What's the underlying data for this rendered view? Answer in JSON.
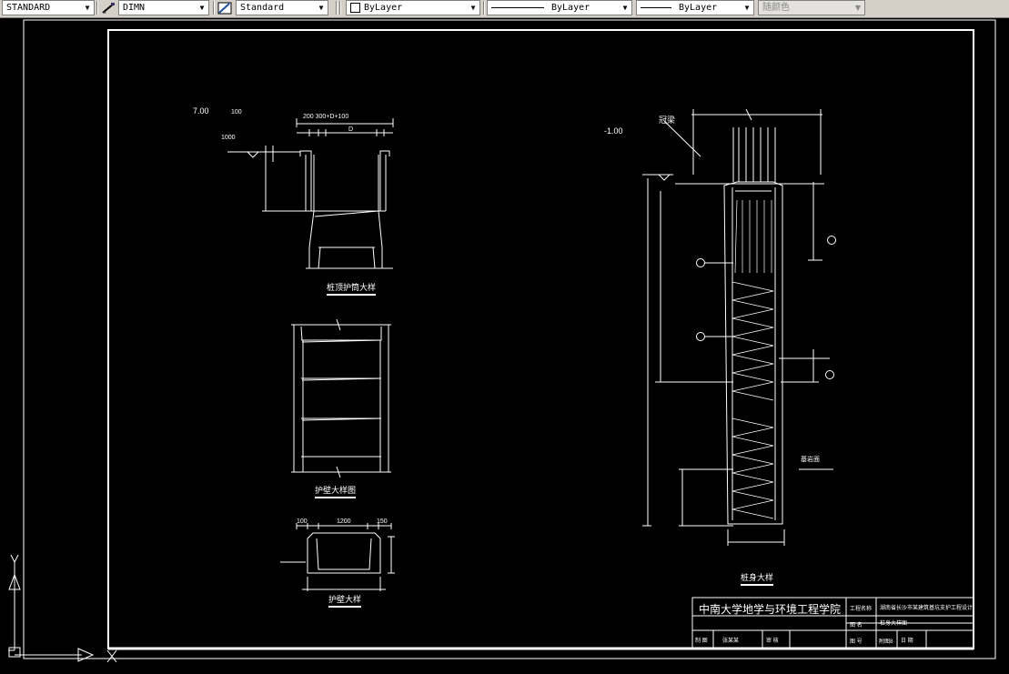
{
  "toolbar": {
    "text_style": "STANDARD",
    "dim_style": "DIMN",
    "table_style": "Standard",
    "layer": "ByLayer",
    "linetype": "ByLayer",
    "lineweight": "ByLayer",
    "color": "随颜色"
  },
  "drawing": {
    "elevations": {
      "e1": "7.00",
      "e2": "-1.00"
    },
    "labels": {
      "pile_top_detail": "桩顶护筒大样",
      "wall_detail_drawing": "护壁大样图",
      "wall_detail": "护壁大样",
      "pile_detail": "桩身大样",
      "crown_beam": "冠梁",
      "rock_surface": "基岩面"
    },
    "dims": {
      "d100": "100",
      "d1000": "1000",
      "d_top": "200  300+D+100",
      "d_D": "D",
      "d_150": "150",
      "d1200": "1200",
      "d100b": "100",
      "d150": "150"
    }
  },
  "title_block": {
    "school": "中南大学地学与环境工程学院",
    "project_name_label": "工程名称",
    "project_name": "湖南省长沙市某建筑基坑支护工程设计",
    "drawing_label": "图  名",
    "drawing_name": "桩身大样图",
    "drawn_by_label": "制  图",
    "designer": "张某某",
    "reviewer_label": "审  核",
    "drawing_no_label": "图  号",
    "sheet_label": "附图8",
    "date_label": "日 期"
  }
}
